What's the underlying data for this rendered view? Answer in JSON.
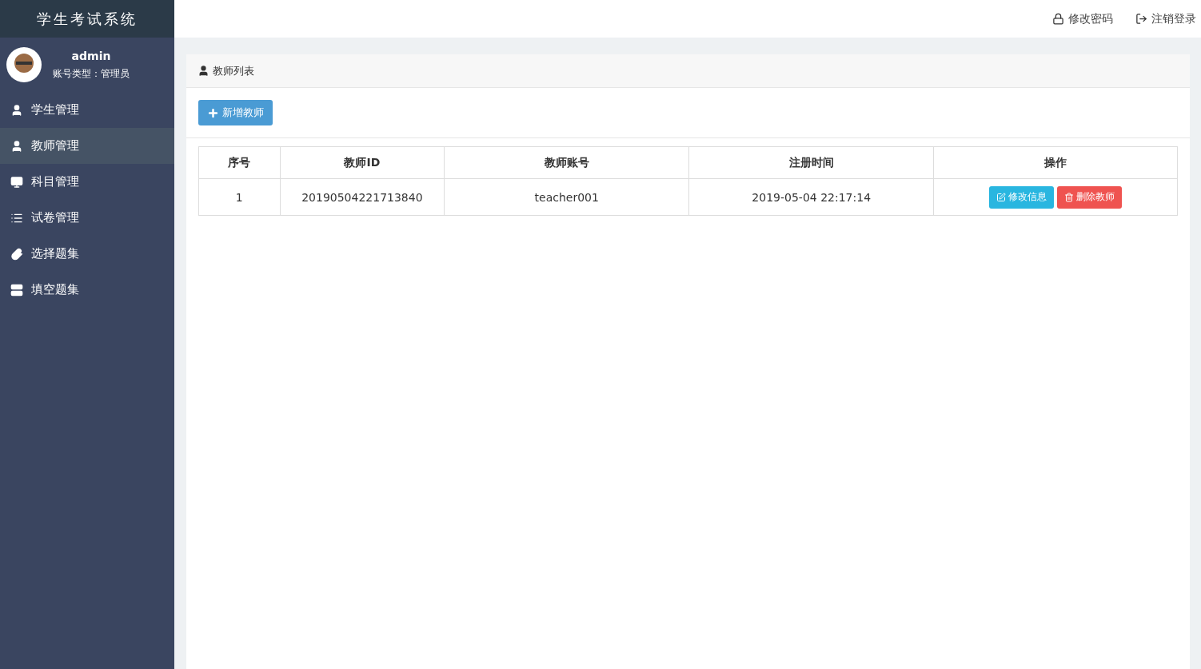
{
  "app_title": "学生考试系统",
  "user": {
    "name": "admin",
    "role": "账号类型：管理员"
  },
  "sidebar": {
    "items": [
      {
        "label": "学生管理",
        "selected": false
      },
      {
        "label": "教师管理",
        "selected": true
      },
      {
        "label": "科目管理",
        "selected": false
      },
      {
        "label": "试卷管理",
        "selected": false
      },
      {
        "label": "选择题集",
        "selected": false
      },
      {
        "label": "填空题集",
        "selected": false
      }
    ]
  },
  "top_bar": {
    "links": [
      {
        "kind": "lock",
        "label": "修改密码"
      },
      {
        "kind": "logout",
        "label": "注销登录"
      }
    ]
  },
  "panel": {
    "title": "教师列表",
    "add_button": "新增教师",
    "table": {
      "columns": [
        "序号",
        "教师ID",
        "教师账号",
        "注册时间",
        "操作"
      ],
      "rows": [
        {
          "cells": [
            "1",
            "20190504221713840",
            "teacher001",
            "2019-05-04 22:17:14"
          ],
          "actions": [
            {
              "kind": "edit",
              "label": "修改信息"
            },
            {
              "kind": "delete",
              "label": "删除教师"
            }
          ]
        }
      ]
    }
  }
}
